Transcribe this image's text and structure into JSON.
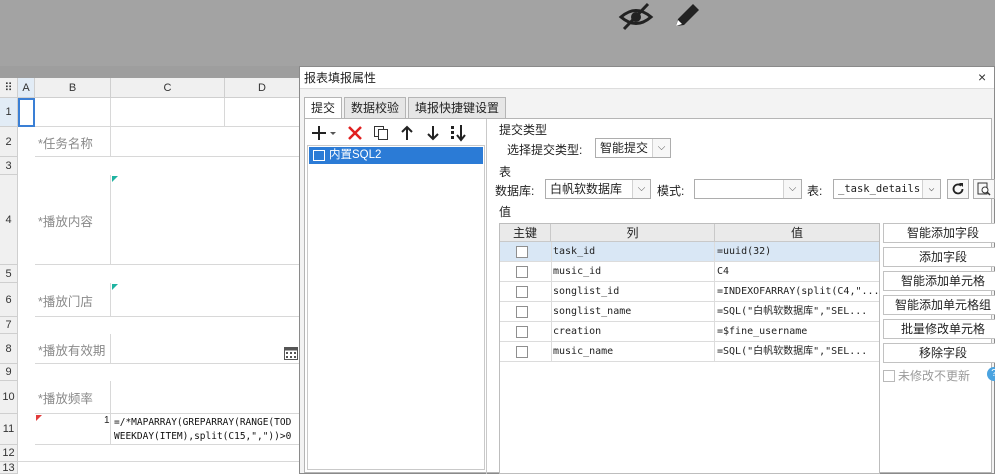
{
  "sheet": {
    "columns": [
      "A",
      "B",
      "C",
      "D"
    ],
    "rows": [
      "1",
      "2",
      "3",
      "4",
      "5",
      "6",
      "7",
      "8",
      "9",
      "10",
      "11",
      "12",
      "13"
    ],
    "labels": {
      "task_name": "*任务名称",
      "content": "*播放内容",
      "store": "*播放门店",
      "validity": "*播放有效期",
      "frequency": "*播放频率"
    },
    "formula_line1": "=/*MAPARRAY(GREPARRAY(RANGE(TOD",
    "formula_line2": "WEEKDAY(ITEM),split(C15,\",\"))>0",
    "b11_value": "1"
  },
  "dialog": {
    "title": "报表填报属性",
    "close": "×",
    "tabs": [
      "提交",
      "数据校验",
      "填报快捷键设置"
    ],
    "list_item": "内置SQL2",
    "submit_type_group": "提交类型",
    "submit_type_label": "选择提交类型:",
    "submit_type_value": "智能提交",
    "table_group": "表",
    "db_label": "数据库:",
    "db_value": "白帆软数据库",
    "mode_label": "模式:",
    "mode_value": "",
    "table_label": "表:",
    "table_value": "_task_details",
    "value_group": "值",
    "grid_headers": [
      "主键",
      "列",
      "值"
    ],
    "grid_rows": [
      {
        "column": "task_id",
        "value": "=uuid(32)"
      },
      {
        "column": "music_id",
        "value": "C4"
      },
      {
        "column": "songlist_id",
        "value": "=INDEXOFARRAY(split(C4,\"..."
      },
      {
        "column": "songlist_name",
        "value": "=SQL(\"白帆软数据库\",\"SEL..."
      },
      {
        "column": "creation",
        "value": "=$fine_username"
      },
      {
        "column": "music_name",
        "value": "=SQL(\"白帆软数据库\",\"SEL..."
      }
    ],
    "buttons": [
      "智能添加字段",
      "添加字段",
      "智能添加单元格",
      "智能添加单元格组",
      "批量修改单元格",
      "移除字段"
    ],
    "unchanged_label": "未修改不更新"
  }
}
